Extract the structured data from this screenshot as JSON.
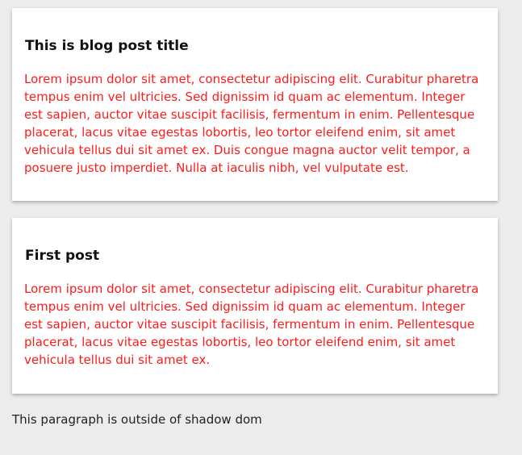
{
  "posts": [
    {
      "title": "This is blog post title",
      "body": "Lorem ipsum dolor sit amet, consectetur adipiscing elit. Curabitur pharetra tempus enim vel ultricies. Sed dignissim id quam ac elementum. Integer est sapien, auctor vitae suscipit facilisis, fermentum in enim. Pellentesque placerat, lacus vitae egestas lobortis, leo tortor eleifend enim, sit amet vehicula tellus dui sit amet ex. Duis congue magna auctor velit tempor, a posuere justo imperdiet. Nulla at iaculis nibh, vel vulputate est."
    },
    {
      "title": "First post",
      "body": "Lorem ipsum dolor sit amet, consectetur adipiscing elit. Curabitur pharetra tempus enim vel ultricies. Sed dignissim id quam ac elementum. Integer est sapien, auctor vitae suscipit facilisis, fermentum in enim. Pellentesque placerat, lacus vitae egestas lobortis, leo tortor eleifend enim, sit amet vehicula tellus dui sit amet ex."
    }
  ],
  "outside_text": "This paragraph is outside of shadow dom",
  "colors": {
    "background": "#ececec",
    "card": "#ffffff",
    "body_text": "#ff1a1a",
    "title_text": "#111111"
  }
}
